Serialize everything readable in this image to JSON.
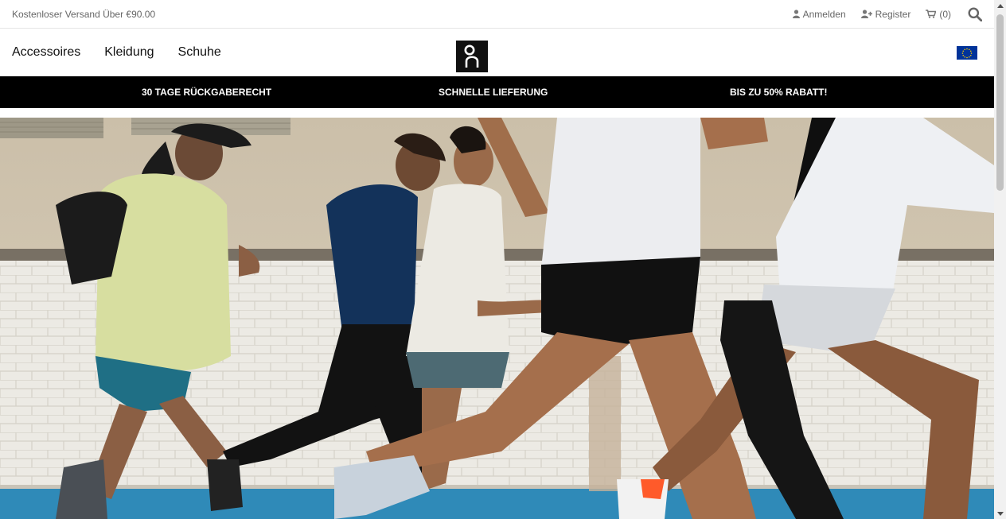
{
  "topbar": {
    "shipping_text": "Kostenloser Versand Über €90.00",
    "login_label": "Anmelden",
    "register_label": "Register",
    "cart_label": "(0)"
  },
  "nav": {
    "items": [
      "Accessoires",
      "Kleidung",
      "Schuhe"
    ]
  },
  "promo": {
    "items": [
      "30 TAGE RÜCKGABERECHT",
      "SCHNELLE LIEFERUNG",
      "BIS ZU 50% RABATT!"
    ]
  },
  "icons": {
    "user": "user-icon",
    "register": "user-plus-icon",
    "cart": "cart-icon",
    "search": "search-icon",
    "logo": "on-logo",
    "flag": "eu-flag-icon"
  },
  "colors": {
    "promo_bg": "#000000",
    "flag_bg": "#003399",
    "flag_stars": "#ffcc00"
  }
}
